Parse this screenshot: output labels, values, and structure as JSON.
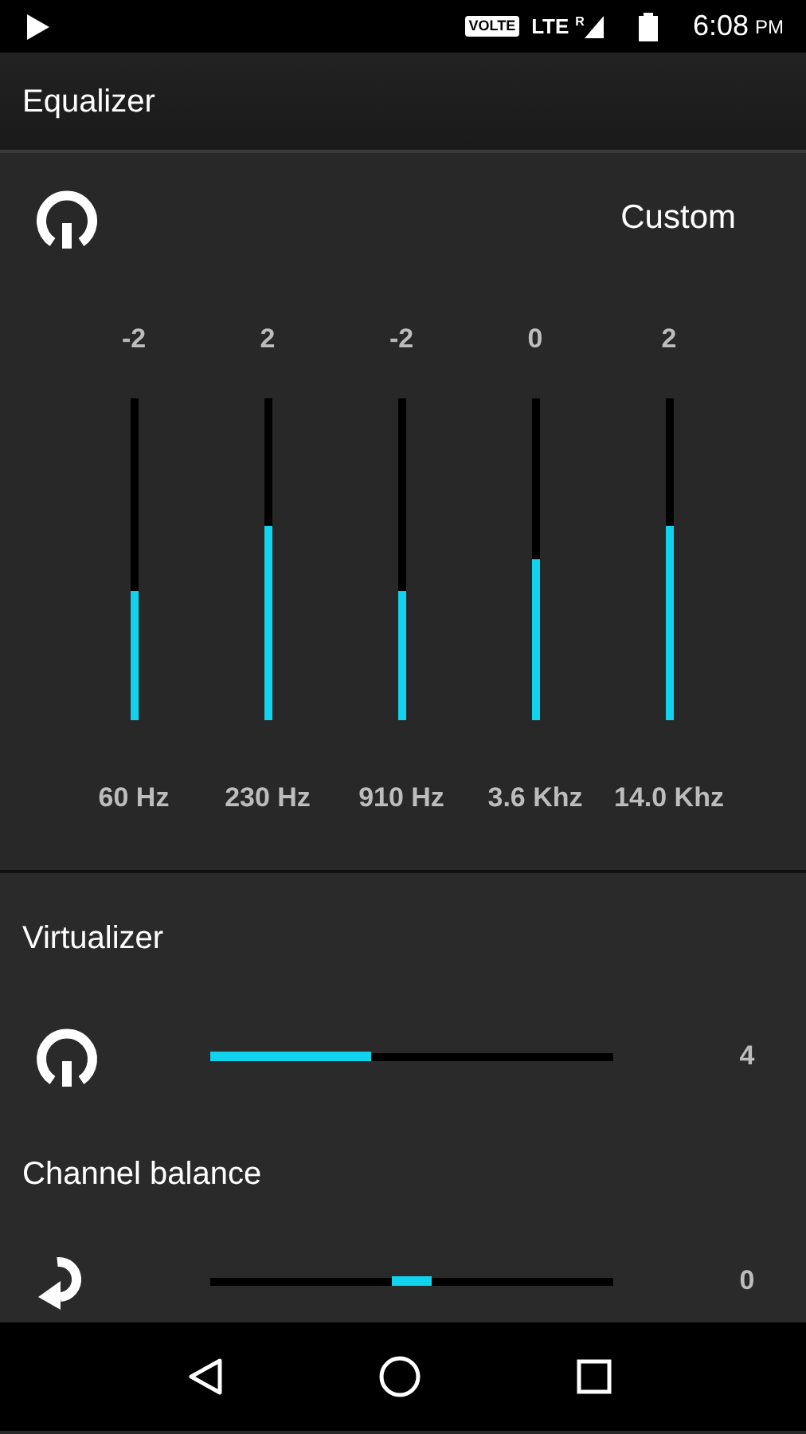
{
  "status_bar": {
    "badge": "VOLTE",
    "network": "LTE",
    "roaming": "R",
    "time": "6:08",
    "meridiem": "PM"
  },
  "title": "Equalizer",
  "equalizer": {
    "preset": "Custom",
    "bands": [
      {
        "value": "-2",
        "level": 0.4,
        "label": "60 Hz"
      },
      {
        "value": "2",
        "level": 0.6,
        "label": "230 Hz"
      },
      {
        "value": "-2",
        "level": 0.4,
        "label": "910 Hz"
      },
      {
        "value": "0",
        "level": 0.5,
        "label": "3.6 Khz"
      },
      {
        "value": "2",
        "level": 0.6,
        "label": "14.0 Khz"
      }
    ]
  },
  "effects": [
    {
      "kind": "strength",
      "title": "Virtualizer",
      "level": 0.4,
      "reading": "4"
    },
    {
      "kind": "balance",
      "title": "Channel balance",
      "level": 0.5,
      "reading": "0"
    }
  ]
}
